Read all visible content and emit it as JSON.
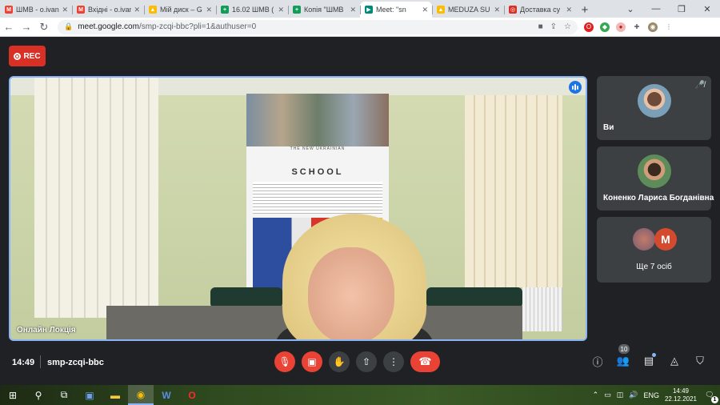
{
  "browser": {
    "tabs": [
      {
        "title": "ШМВ - o.ivan",
        "icon": "gmail-icon",
        "color": "#ea4335",
        "glyph": "M",
        "active": false
      },
      {
        "title": "Вхідні - o.ivan",
        "icon": "gmail-icon",
        "color": "#ea4335",
        "glyph": "M",
        "active": false
      },
      {
        "title": "Мій диск – G",
        "icon": "drive-icon",
        "color": "#fbbc04",
        "glyph": "▲",
        "active": false
      },
      {
        "title": "16.02 ШМВ (",
        "icon": "sheets-icon",
        "color": "#0f9d58",
        "glyph": "+",
        "active": false
      },
      {
        "title": "Копія \"ШМВ",
        "icon": "sheets-icon",
        "color": "#0f9d58",
        "glyph": "+",
        "active": false
      },
      {
        "title": "Meet: \"sn",
        "icon": "meet-icon",
        "color": "#00897b",
        "glyph": "▶",
        "active": true
      },
      {
        "title": "MEDUZA SU",
        "icon": "drive-icon",
        "color": "#fbbc04",
        "glyph": "▲",
        "active": false
      },
      {
        "title": "Доставка су",
        "icon": "delivery-icon",
        "color": "#d93025",
        "glyph": "◎",
        "active": false
      }
    ],
    "url_host": "meet.google.com",
    "url_path": "/smp-zcqi-bbc?pli=1&authuser=0"
  },
  "meet": {
    "rec_label": "REC",
    "main_name": "Онлайн Локція",
    "participants": [
      {
        "name": "Ви",
        "muted": true
      },
      {
        "name": "Коненко Лариса Богданівна",
        "muted": false
      },
      {
        "name": "Ще 7 осіб",
        "avatar_letter": "M"
      }
    ],
    "poster_title": "SCHOOL",
    "poster_subtitle": "THE NEW UKRAINIAN",
    "clock": "14:49",
    "meeting_code": "smp-zcqi-bbc",
    "participant_count": "10"
  },
  "taskbar": {
    "lang": "ENG",
    "time": "14:49",
    "date": "22.12.2021",
    "notifications": "1"
  }
}
